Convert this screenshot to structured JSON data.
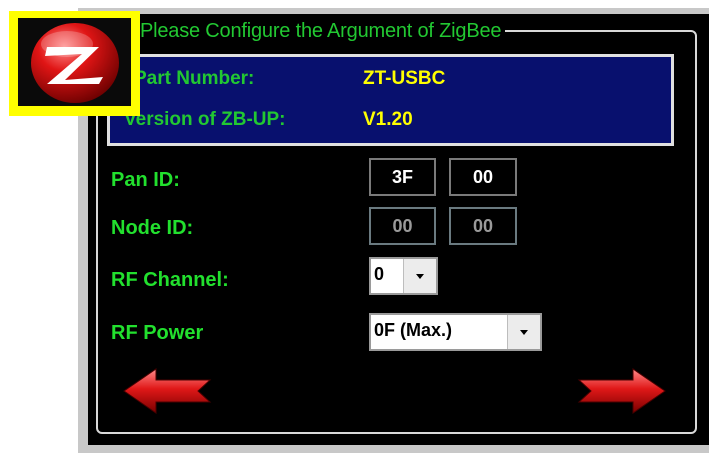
{
  "group": {
    "title": "Please Configure the Argument of ZigBee"
  },
  "info": {
    "part_label": "Part Number:",
    "part_value": "ZT-USBC",
    "version_label": "Version of ZB-UP:",
    "version_value": "V1.20"
  },
  "pan_id": {
    "label": "Pan ID:",
    "values": [
      "3F",
      "00"
    ]
  },
  "node_id": {
    "label": "Node ID:",
    "values": [
      "00",
      "00"
    ]
  },
  "rf_channel": {
    "label": "RF Channel:",
    "selected": "0"
  },
  "rf_power": {
    "label": "RF Power",
    "selected": "0F (Max.)"
  },
  "icons": {
    "logo": "zigbee-logo-icon",
    "back": "red-arrow-left-icon",
    "next": "red-arrow-right-icon"
  },
  "colors": {
    "background": "#000000",
    "label_green": "#22e02e",
    "info_bg": "#08106e",
    "value_yellow": "#ffff00",
    "logo_frame": "#ffff00",
    "arrow_red": "#d81818"
  }
}
